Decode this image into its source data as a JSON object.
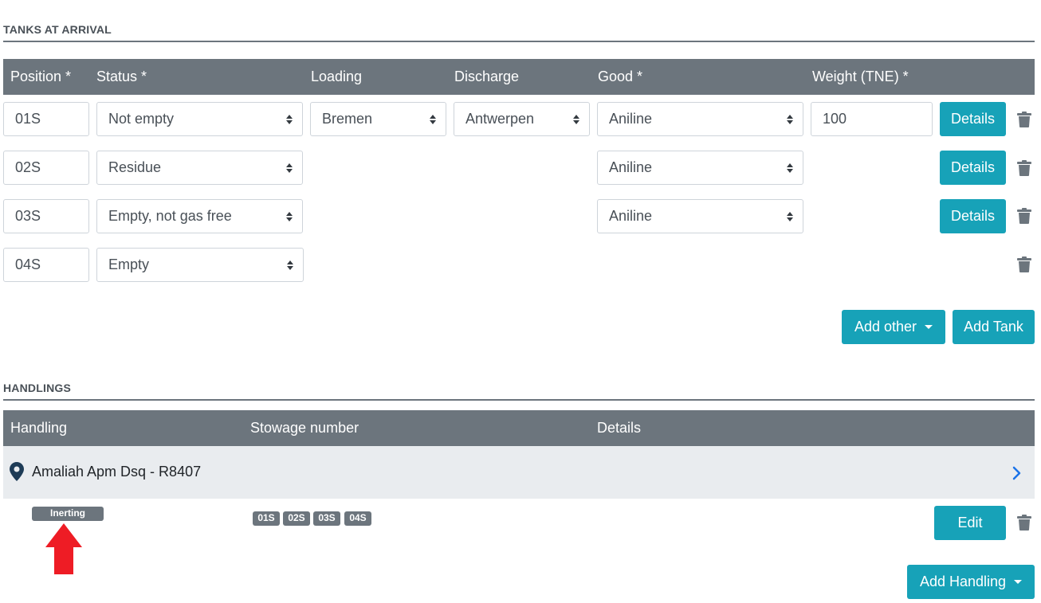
{
  "tanks": {
    "title": "TANKS AT ARRIVAL",
    "columns": {
      "position": "Position *",
      "status": "Status *",
      "loading": "Loading",
      "discharge": "Discharge",
      "good": "Good *",
      "weight": "Weight (TNE) *"
    },
    "rows": [
      {
        "position": "01S",
        "status": "Not empty",
        "loading": "Bremen",
        "discharge": "Antwerpen",
        "good": "Aniline",
        "weight": "100",
        "details": "Details"
      },
      {
        "position": "02S",
        "status": "Residue",
        "good": "Aniline",
        "details": "Details"
      },
      {
        "position": "03S",
        "status": "Empty, not gas free",
        "good": "Aniline",
        "details": "Details"
      },
      {
        "position": "04S",
        "status": "Empty"
      }
    ],
    "add_other_label": "Add other",
    "add_tank_label": "Add Tank"
  },
  "handlings": {
    "title": "HANDLINGS",
    "columns": {
      "handling": "Handling",
      "stowage": "Stowage number",
      "details": "Details"
    },
    "location": "Amaliah Apm Dsq - R8407",
    "item": {
      "type_badge": "Inerting",
      "stowage": [
        "01S",
        "02S",
        "03S",
        "04S"
      ],
      "edit_label": "Edit"
    },
    "add_handling_label": "Add Handling"
  },
  "colors": {
    "header": "#6c757d",
    "accent": "#17a2b8",
    "row_highlight": "#e9ecef",
    "annotation_arrow": "#ee1c25"
  }
}
